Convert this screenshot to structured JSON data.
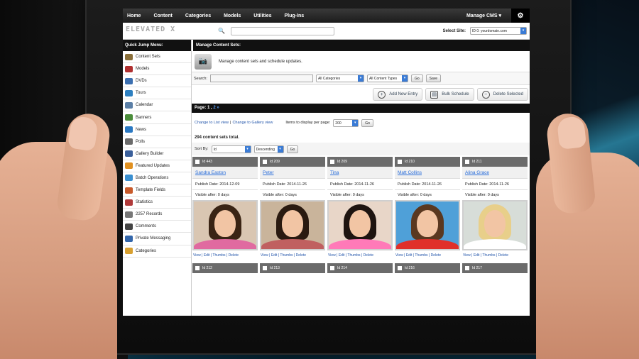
{
  "topnav": {
    "items": [
      "Home",
      "Content",
      "Categories",
      "Models",
      "Utilities",
      "Plug-Ins"
    ],
    "manage_cms": "Manage CMS ▾"
  },
  "header": {
    "logo_text": "ELEVATED X",
    "select_site_label": "Select Site:",
    "select_site_value": "ID 0: yourdomain.com"
  },
  "sidebar": {
    "title": "Quick Jump Menu:",
    "items": [
      {
        "label": "Content Sets",
        "color": "#8a6f3a"
      },
      {
        "label": "Models",
        "color": "#b03030"
      },
      {
        "label": "DVDs",
        "color": "#3b6fb0"
      },
      {
        "label": "Tours",
        "color": "#2d7fc0"
      },
      {
        "label": "Calendar",
        "color": "#5b7fa6"
      },
      {
        "label": "Banners",
        "color": "#4a8c3a"
      },
      {
        "label": "News",
        "color": "#2a78c2"
      },
      {
        "label": "Polls",
        "color": "#6a6a6a"
      },
      {
        "label": "Gallery Builder",
        "color": "#3a5f9a"
      },
      {
        "label": "Featured Updates",
        "color": "#e09020"
      },
      {
        "label": "Batch Operations",
        "color": "#3a8fd0"
      },
      {
        "label": "Template Fields",
        "color": "#c85a2a"
      },
      {
        "label": "Statistics",
        "color": "#b03a3a"
      },
      {
        "label": "2257 Records",
        "color": "#777777"
      },
      {
        "label": "Comments",
        "color": "#444444"
      },
      {
        "label": "Private Messaging",
        "color": "#3366aa"
      },
      {
        "label": "Categories",
        "color": "#d8a030"
      }
    ]
  },
  "main": {
    "section_title": "Manage Content Sets:",
    "description": "Manage content sets and schedule updates.",
    "search_label": "Search:",
    "categories_dd": "All Categories",
    "types_dd": "All Content Types",
    "go_label": "Go",
    "save_label": "Save",
    "add_new": "Add New Entry",
    "bulk_schedule": "Bulk Schedule",
    "delete_selected": "Delete Selected",
    "pager_label": "Page:",
    "pager_current": "1",
    "pager_next": "2",
    "pager_arrow": "»",
    "list_view": "Change to List view",
    "gallery_view": "Change to Gallery view",
    "per_page_label": "Items to display per page:",
    "per_page_value": "200",
    "total_text": "294 content sets total.",
    "sort_label": "Sort By:",
    "sort_field": "Id",
    "sort_order": "Descending"
  },
  "cards": [
    {
      "id": "Id 443",
      "name": "Sandra Easton",
      "date": "Publish Date: 2014-12-09",
      "visible": "Visible after: 0 days",
      "bg": "#d9c6b2",
      "hair": "#3a2414",
      "shirt": "#e06aa0"
    },
    {
      "id": "Id 209",
      "name": "Peter",
      "date": "Publish Date: 2014-11-26",
      "visible": "Visible after: 0 days",
      "bg": "#c9b49b",
      "hair": "#2a1a10",
      "shirt": "#c06060"
    },
    {
      "id": "Id 209",
      "name": "Tina",
      "date": "Publish Date: 2014-11-26",
      "visible": "Visible after: 0 days",
      "bg": "#e8d6c8",
      "hair": "#1e1410",
      "shirt": "#ff7ab8"
    },
    {
      "id": "Id 210",
      "name": "Matt Collins",
      "date": "Publish Date: 2014-11-26",
      "visible": "Visible after: 0 days",
      "bg": "#4fa0d8",
      "hair": "#5a3820",
      "shirt": "#e0302a"
    },
    {
      "id": "Id 211",
      "name": "Alina Grace",
      "date": "Publish Date: 2014-11-26",
      "visible": "Visible after: 0 days",
      "bg": "#d7ddd8",
      "hair": "#e8cf8a",
      "shirt": "#ffffff"
    }
  ],
  "card_links": "View | Edit | Thumbs | Delete",
  "row2_ids": [
    "Id 212",
    "Id 213",
    "Id 214",
    "Id 216",
    "Id 217"
  ]
}
